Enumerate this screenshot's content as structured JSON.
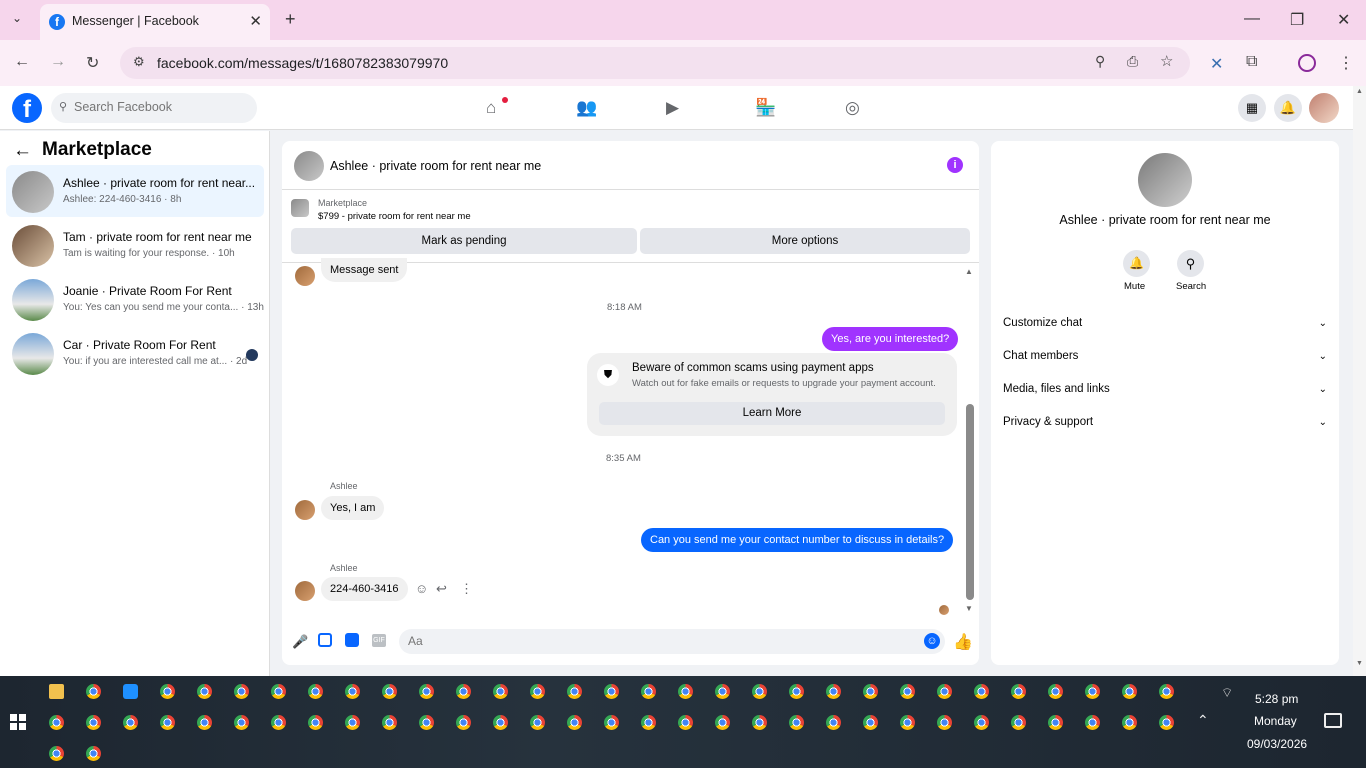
{
  "browser": {
    "tab_title": "Messenger | Facebook",
    "new_tab": "+",
    "url": "facebook.com/messages/t/1680782383079970"
  },
  "fb": {
    "logo": "f",
    "search_placeholder": "Search Facebook"
  },
  "left": {
    "title": "Marketplace",
    "conversations": [
      {
        "name": "Ashlee · private room for rent near...",
        "preview": "Ashlee: 224-460-3416 · 8h"
      },
      {
        "name": "Tam · private room for rent near me",
        "preview": "Tam is waiting for your response. · 10h"
      },
      {
        "name": "Joanie · Private Room For Rent",
        "preview": "You: Yes can you send me your conta... · 13h"
      },
      {
        "name": "Car · Private Room For Rent",
        "preview": "You: if you are interested call me at... · 2d"
      }
    ]
  },
  "chat": {
    "title": "Ashlee · private room for rent near me",
    "listing_label": "Marketplace",
    "listing_title": "$799 - private room for rent near me",
    "mark_pending": "Mark as pending",
    "more_options": "More options",
    "msg_sent": "Message sent",
    "time1": "8:18 AM",
    "out1": "Yes, are you interested?",
    "scam_title": "Beware of common scams using payment apps",
    "scam_desc": "Watch out for fake emails or requests to upgrade your payment account.",
    "learn_more": "Learn More",
    "time2": "8:35 AM",
    "sender1": "Ashlee",
    "in1": "Yes, I am",
    "out2": "Can you send me your contact number to discuss in details?",
    "sender2": "Ashlee",
    "in2": "224-460-3416",
    "composer_placeholder": "Aa"
  },
  "right": {
    "name": "Ashlee · private room for rent near me",
    "mute": "Mute",
    "search": "Search",
    "sections": [
      "Customize chat",
      "Chat members",
      "Media, files and links",
      "Privacy & support"
    ]
  },
  "taskbar": {
    "time": "5:28 pm",
    "day": "Monday",
    "date": "09/03/2026"
  }
}
